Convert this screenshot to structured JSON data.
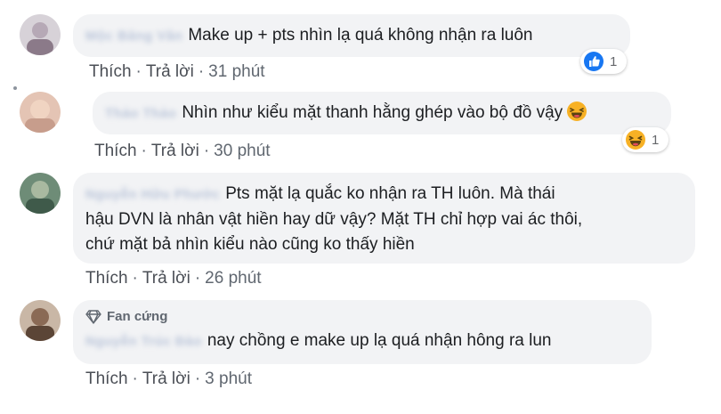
{
  "comments": [
    {
      "author": "Mộc Băng Vân",
      "text": "Make up + pts nhìn lạ quá không nhận ra luôn",
      "actions": {
        "like": "Thích",
        "reply": "Trả lời",
        "time": "31 phút"
      },
      "reaction": {
        "icon": "thumbs-up-icon",
        "count": "1"
      }
    },
    {
      "author": "Thảo Thảo",
      "text": "Nhìn như kiểu mặt thanh hằng ghép vào bộ đồ vậy",
      "actions": {
        "like": "Thích",
        "reply": "Trả lời",
        "time": "30 phút"
      },
      "reaction": {
        "icon": "haha-icon",
        "count": "1"
      }
    },
    {
      "author": "Nguyễn Hữu Phước",
      "text_lines": [
        "Pts mặt lạ quắc ko nhận ra TH luôn. Mà thái",
        "hậu DVN là nhân vật hiền hay dữ vậy? Mặt TH chỉ hợp vai ác thôi,",
        "chứ mặt bả nhìn kiểu nào cũng ko thấy hiền"
      ],
      "actions": {
        "like": "Thích",
        "reply": "Trả lời",
        "time": "26 phút"
      }
    },
    {
      "badge": "Fan cứng",
      "author": "Nguyễn Trúc Đào",
      "text": "nay chồng e make up lạ quá nhận hông ra lun",
      "actions": {
        "like": "Thích",
        "reply": "Trả lời",
        "time": "3 phút"
      }
    }
  ],
  "separator": "·",
  "colors": {
    "bubble": "#f2f3f5",
    "like_blue": "#1877f2",
    "haha_yellow": "#f7b125"
  }
}
